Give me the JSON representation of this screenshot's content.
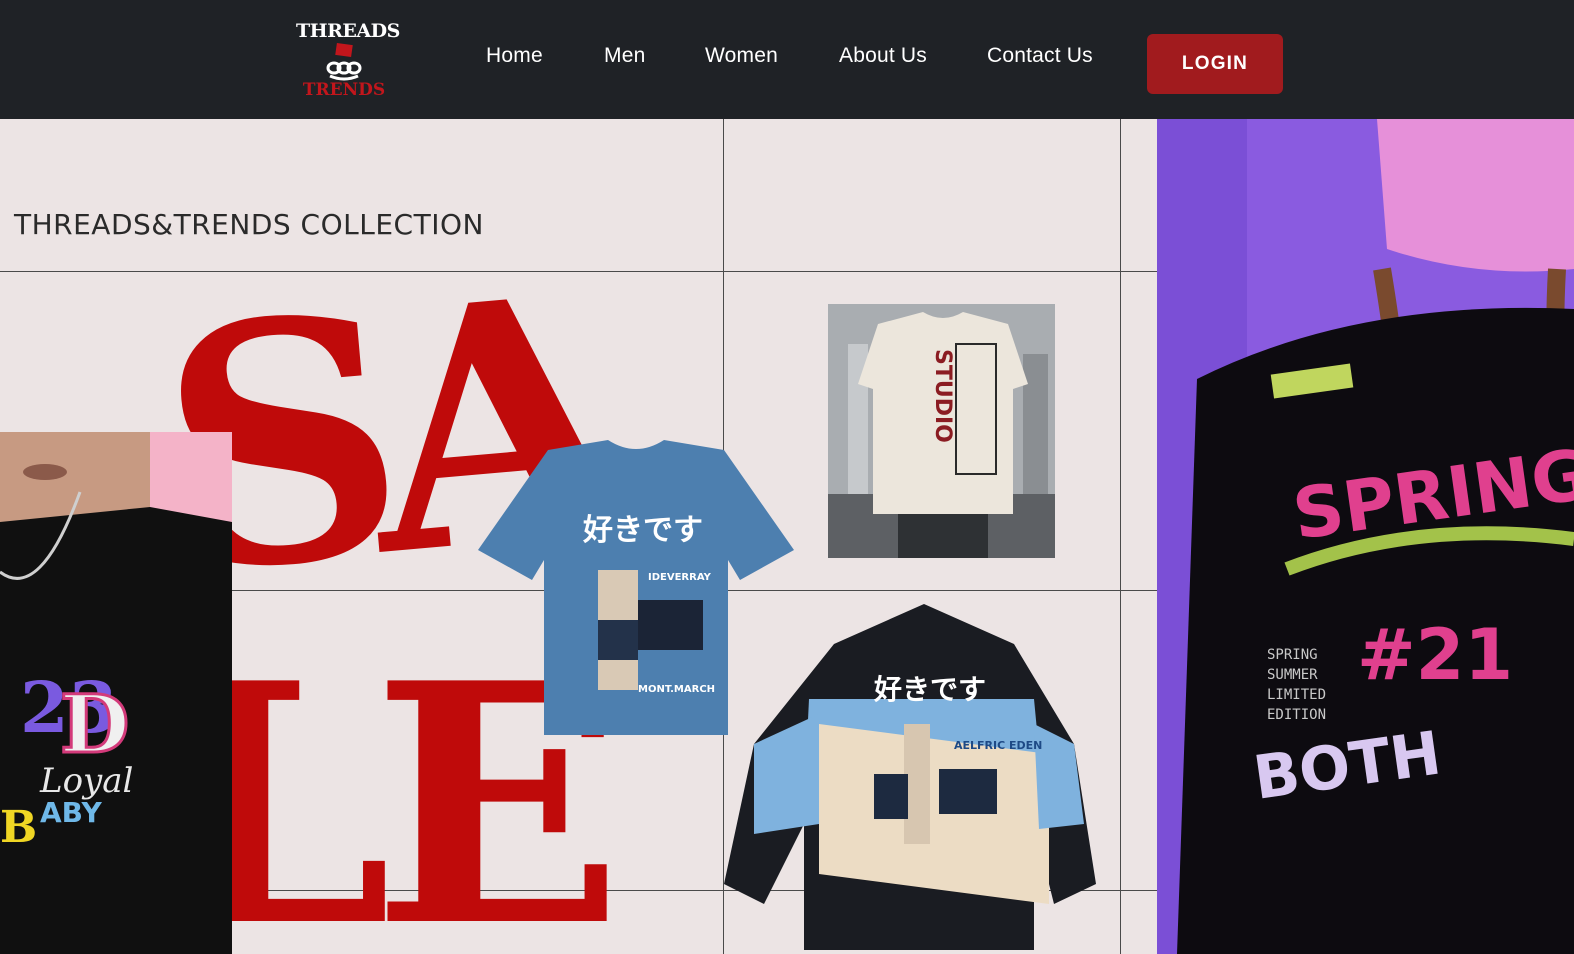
{
  "header": {
    "logo_top": "THREADS",
    "logo_bottom": "TRENDS",
    "nav": [
      {
        "label": "Home"
      },
      {
        "label": "Men"
      },
      {
        "label": "Women"
      },
      {
        "label": "About Us"
      },
      {
        "label": "Contact Us"
      }
    ],
    "login_label": "LOGIN"
  },
  "hero": {
    "collection_title": "THREADS&TRENDS COLLECTION",
    "sale_top": "SA",
    "sale_bottom": "LE"
  },
  "colors": {
    "header_bg": "#1f2226",
    "accent": "#a11b1e",
    "sale_red": "#bf0a0a",
    "page_bg": "#ece4e4"
  }
}
